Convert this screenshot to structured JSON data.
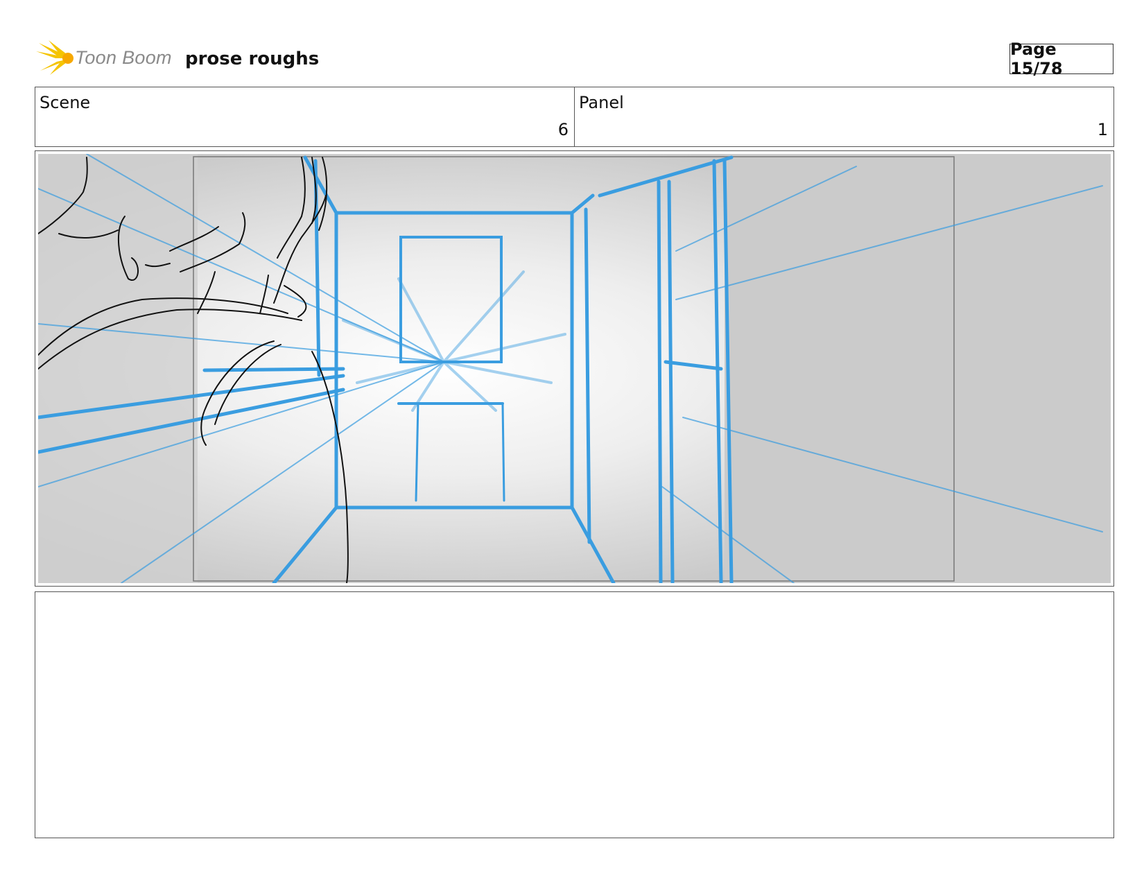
{
  "header": {
    "logo_text": "Toon Boom",
    "logo_icon": "sunburst-logo-icon",
    "project_title": "prose roughs",
    "page_label": "Page 15/78"
  },
  "info": {
    "scene_label": "Scene",
    "scene_value": "6",
    "panel_label": "Panel",
    "panel_value": "1"
  },
  "colors": {
    "sketch_blue": "#3a9de0",
    "sketch_black": "#111111",
    "wall_grey": "#c8c8c8",
    "logo_yellow": "#f5c400"
  },
  "notes": {
    "text": ""
  }
}
